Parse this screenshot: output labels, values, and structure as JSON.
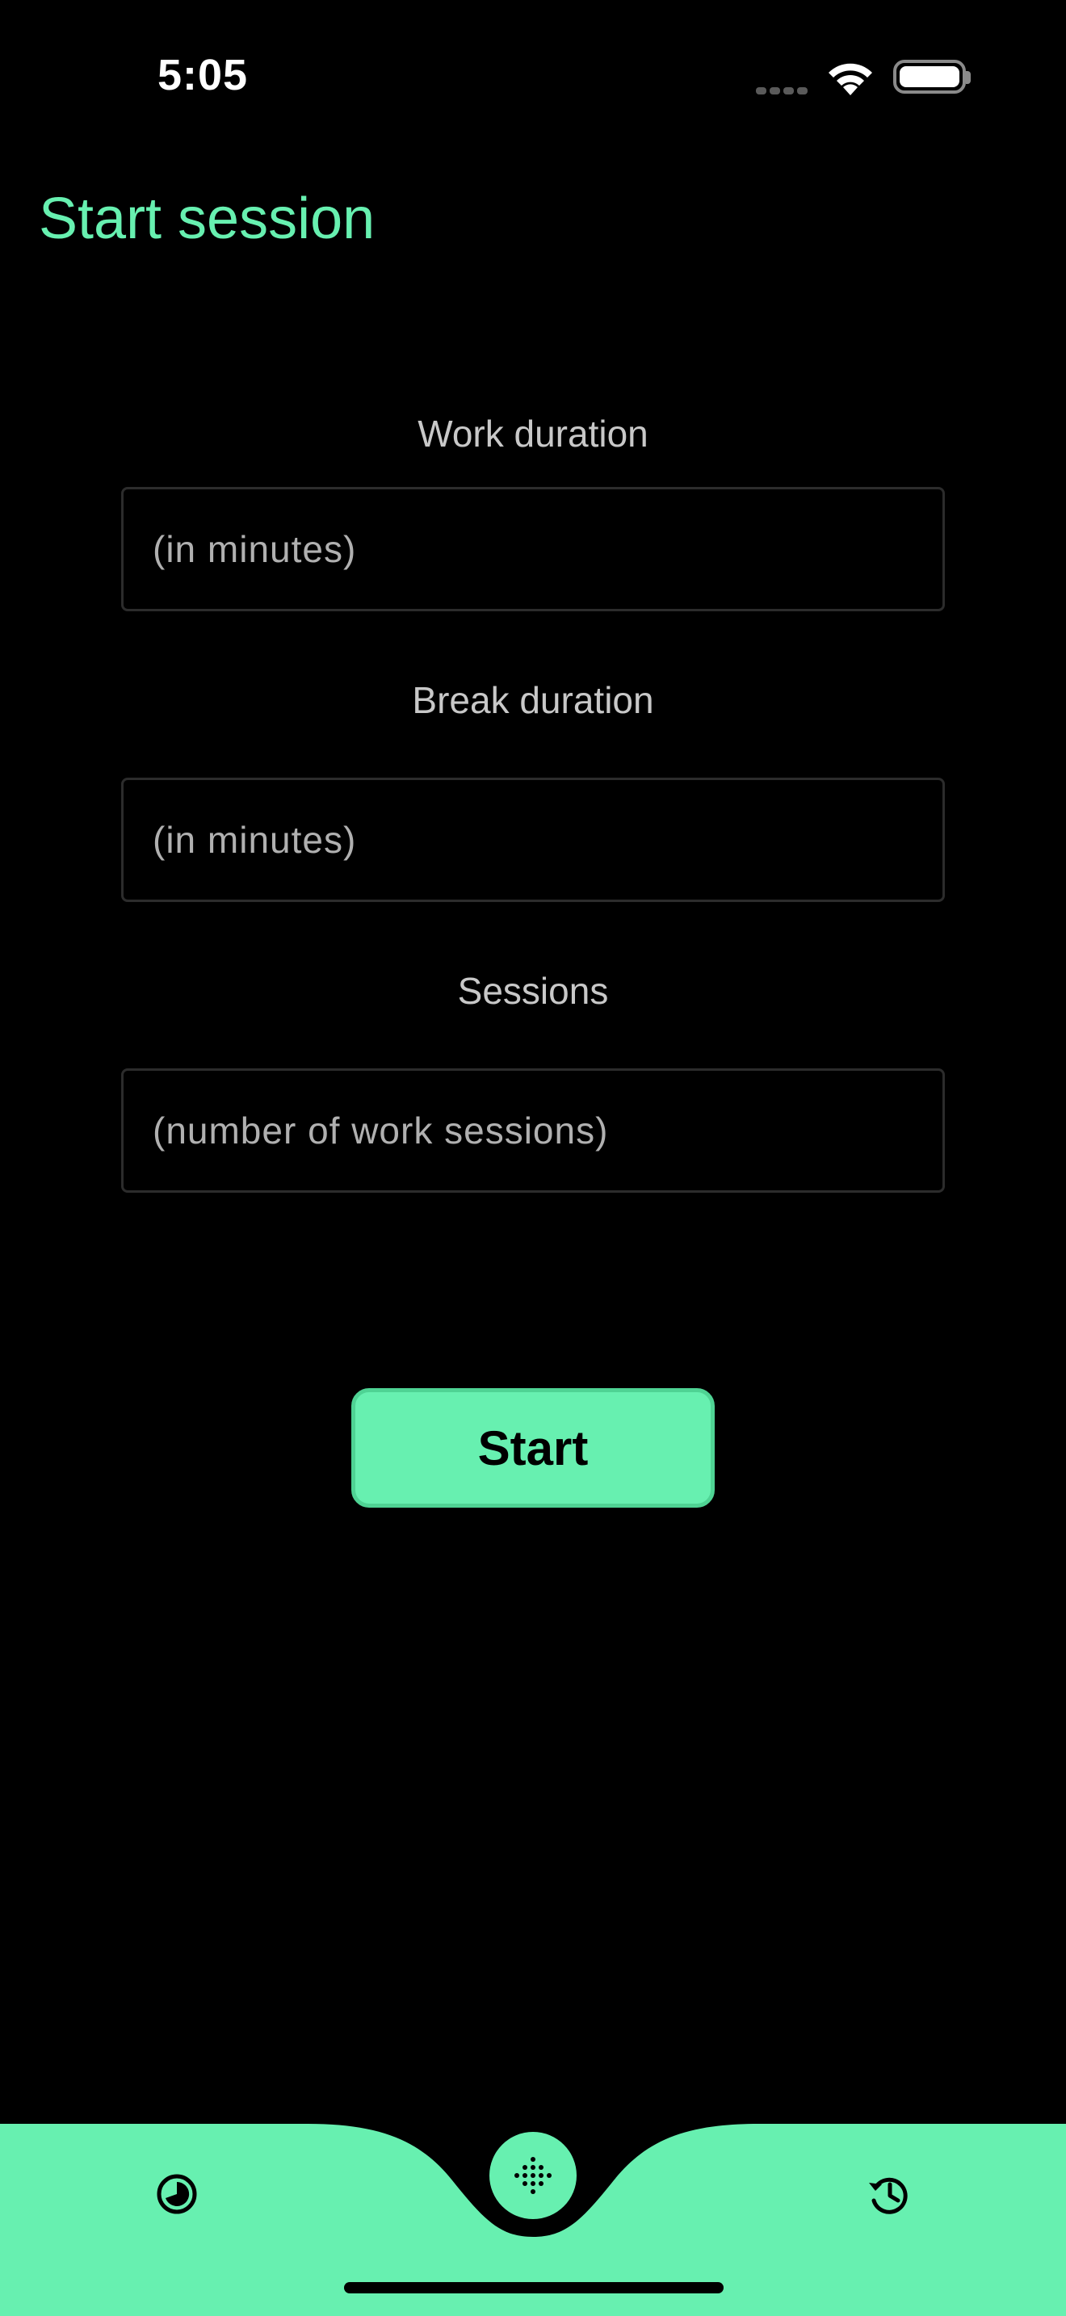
{
  "status_bar": {
    "time": "5:05"
  },
  "header": {
    "title": "Start session"
  },
  "form": {
    "work": {
      "label": "Work duration",
      "placeholder": "(in minutes)"
    },
    "break": {
      "label": "Break duration",
      "placeholder": "(in minutes)"
    },
    "sessions": {
      "label": "Sessions",
      "placeholder": "(number of work sessions)"
    },
    "start_label": "Start"
  },
  "nav": {
    "items": [
      {
        "icon": "pie-timer-icon"
      },
      {
        "icon": "dots-grid-icon"
      },
      {
        "icon": "history-icon"
      }
    ]
  },
  "colors": {
    "accent": "#67f0b0",
    "background": "#000000"
  }
}
